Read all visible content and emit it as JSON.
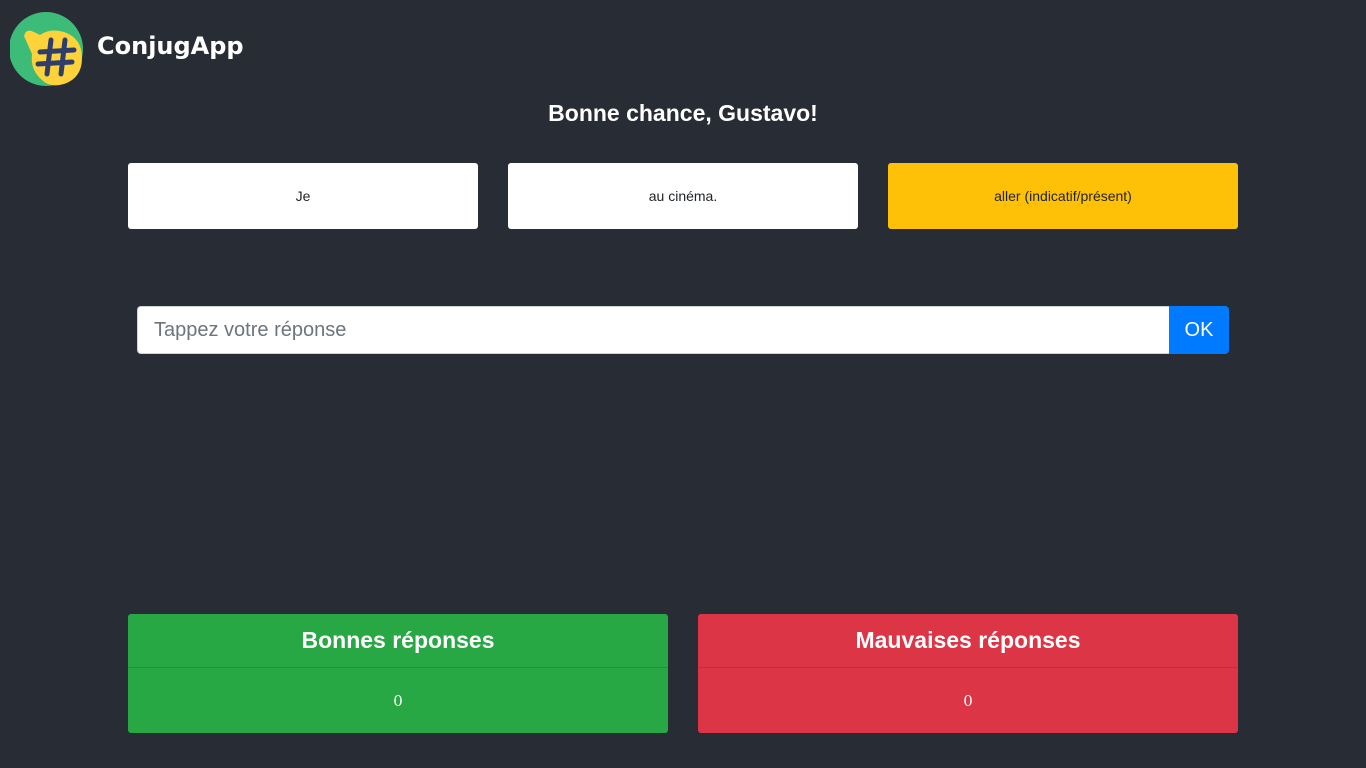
{
  "header": {
    "app_title": "ConjugApp",
    "logo_icon": "hashtag-speech-bubble-icon",
    "logo_colors": {
      "bubble_back": "#3dbb78",
      "bubble_front": "#fdd23b",
      "hash": "#2f3d6b"
    }
  },
  "greeting": "Bonne chance, Gustavo!",
  "exercise": {
    "subject": "Je",
    "complement": "au cinéma.",
    "verb_hint": "aller (indicatif/présent)"
  },
  "answer": {
    "placeholder": "Tappez votre réponse",
    "value": "",
    "submit_label": "OK"
  },
  "scores": {
    "correct": {
      "title": "Bonnes réponses",
      "count": "0"
    },
    "wrong": {
      "title": "Mauvaises réponses",
      "count": "0"
    }
  },
  "colors": {
    "background": "#282c34",
    "hint_card": "#ffc107",
    "submit": "#007bff",
    "correct": "#28a745",
    "wrong": "#dc3545"
  }
}
